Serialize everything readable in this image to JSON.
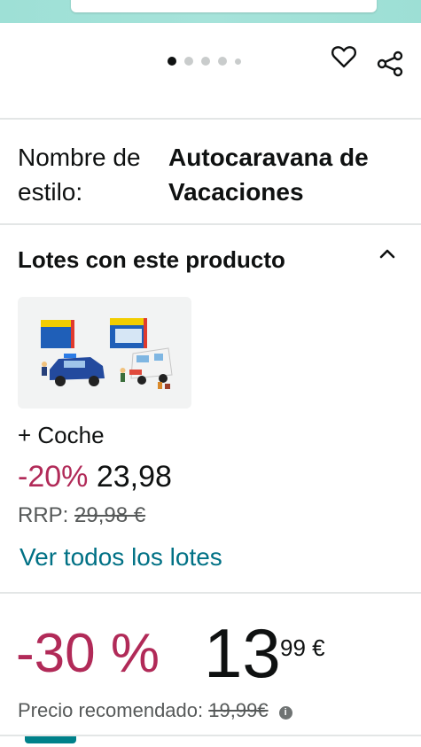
{
  "carousel": {
    "total": 5,
    "active_index": 0
  },
  "actions": {
    "wishlist_icon": "heart-icon",
    "share_icon": "share-icon"
  },
  "style": {
    "label": "Nombre de estilo:",
    "value": "Autocaravana de Vacaciones"
  },
  "bundles": {
    "title": "Lotes con este producto",
    "caret_icon": "chevron-up-icon",
    "item": {
      "name": "+ Coche",
      "discount": "-20%",
      "price": "23,98",
      "rrp_label": "RRP:",
      "rrp_value": "29,98 €"
    },
    "see_all": "Ver todos los lotes"
  },
  "price": {
    "discount": "-30 %",
    "whole": "13",
    "fraction_currency": "99 €",
    "recommended_label": "Precio recomendado:",
    "recommended_value": "19,99€",
    "info_icon": "info-icon"
  },
  "colors": {
    "discount": "#b12a58",
    "link": "#007185",
    "header": "#a6e3da"
  }
}
